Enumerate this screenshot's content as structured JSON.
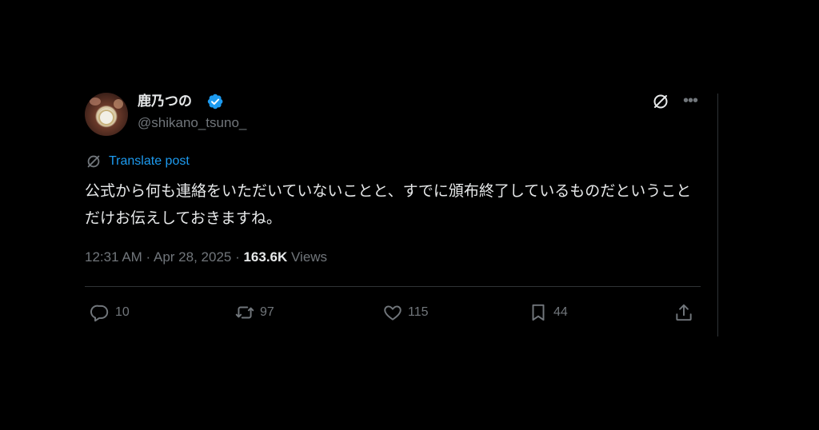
{
  "author": {
    "display_name": "鹿乃つの",
    "handle": "@shikano_tsuno_",
    "verified_icon": "verified-badge-icon",
    "accent_color": "#1d9bf0"
  },
  "header_icons": [
    "grok-icon",
    "more-icon"
  ],
  "translate": {
    "label": "Translate post",
    "icon": "translate-icon"
  },
  "tweet": {
    "text": "公式から何も連絡をいただいていないことと、すでに頒布終了しているものだということだけお伝えしておきますね。"
  },
  "meta": {
    "timestamp": "12:31 AM · Apr 28, 2025 · ",
    "views_count": "163.6K",
    "views_label": " Views"
  },
  "actions": {
    "replies": "10",
    "reposts": "97",
    "likes": "115",
    "bookmarks": "44"
  }
}
